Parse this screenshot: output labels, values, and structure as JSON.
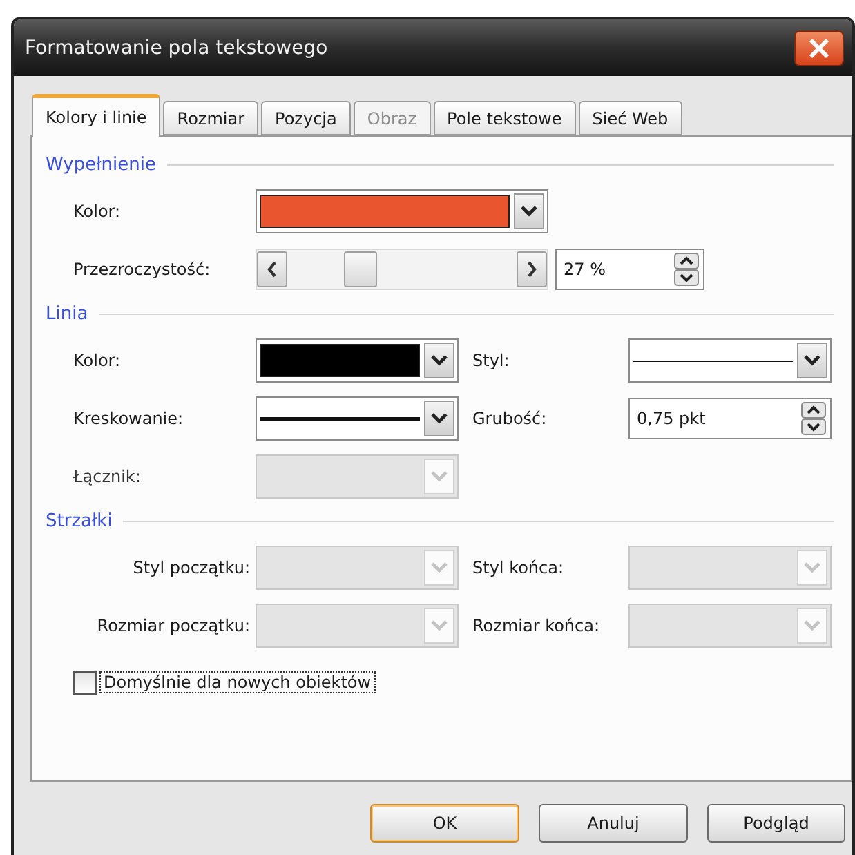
{
  "window": {
    "title": "Formatowanie pola tekstowego"
  },
  "tabs": [
    {
      "label": "Kolory i linie",
      "selected": true,
      "disabled": false
    },
    {
      "label": "Rozmiar",
      "selected": false,
      "disabled": false
    },
    {
      "label": "Pozycja",
      "selected": false,
      "disabled": false
    },
    {
      "label": "Obraz",
      "selected": false,
      "disabled": true
    },
    {
      "label": "Pole tekstowe",
      "selected": false,
      "disabled": false
    },
    {
      "label": "Sieć Web",
      "selected": false,
      "disabled": false
    }
  ],
  "fill": {
    "title": "Wypełnienie",
    "color_label": "Kolor:",
    "color": "#e8552f",
    "transparency_label": "Przezroczystość:",
    "transparency": {
      "level": 0.39
    },
    "transparency_value": "27 %"
  },
  "line": {
    "title": "Linia",
    "color_label": "Kolor:",
    "color": "#000000",
    "style_label": "Styl:",
    "dash_label": "Kreskowanie:",
    "weight_label": "Grubość:",
    "weight_value": "0,75 pkt",
    "connector_label": "Łącznik:",
    "connector_disabled": true
  },
  "arrows": {
    "title": "Strzałki",
    "fields": [
      {
        "label": "Styl początku:",
        "disabled": true
      },
      {
        "label": "Styl końca:",
        "disabled": true
      },
      {
        "label": "Rozmiar początku:",
        "disabled": true
      },
      {
        "label": "Rozmiar końca:",
        "disabled": true
      }
    ]
  },
  "default_checkbox": {
    "label": "Domyślnie dla nowych obiektów",
    "checked": false
  },
  "buttons": [
    {
      "label": "OK",
      "default": true
    },
    {
      "label": "Anuluj",
      "default": false
    },
    {
      "label": "Podgląd",
      "default": false
    }
  ]
}
